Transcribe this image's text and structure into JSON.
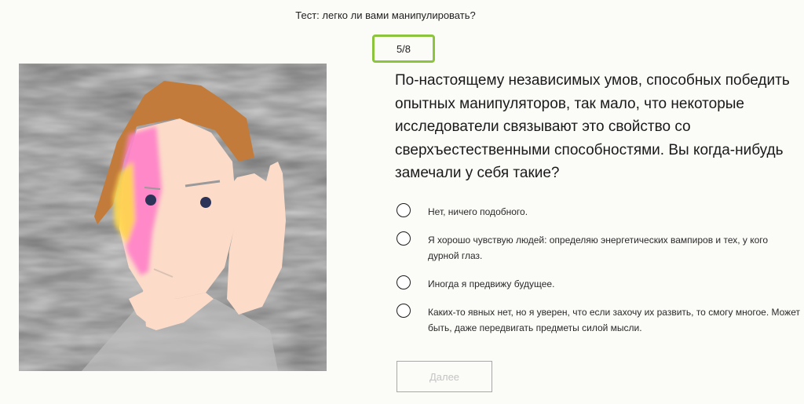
{
  "header": {
    "title": "Тест: легко ли вами манипулировать?"
  },
  "progress": {
    "label": "5/8",
    "current": 5,
    "total": 8,
    "accent_color": "#8cc43e"
  },
  "question": {
    "text": "По-настоящему независимых умов, способных победить опытных манипуляторов, так мало, что некоторые исследователи связывают это свойство со сверхъестественными способностями. Вы когда-нибудь замечали у себя такие?"
  },
  "answers": [
    {
      "label": "Нет, ничего подобного."
    },
    {
      "label": "Я хорошо чувствую людей: определяю энергетических вампиров и тех, у кого дурной глаз."
    },
    {
      "label": "Иногда я предвижу будущее."
    },
    {
      "label": "Каких-то явных нет, но я уверен, что если захочу их развить, то смогу многое. Может быть, даже передвигать предметы силой мысли."
    }
  ],
  "actions": {
    "next_label": "Далее",
    "next_enabled": false
  },
  "illustration": {
    "description_icon": "portrait-illustration",
    "colors": {
      "background": "#c3c3c3",
      "hair": "#c27b3a",
      "skin": "#fcdcc9",
      "highlight_pink": "#ff7fc8",
      "highlight_yellow": "#ffd84a",
      "eyes": "#2b3358"
    }
  }
}
